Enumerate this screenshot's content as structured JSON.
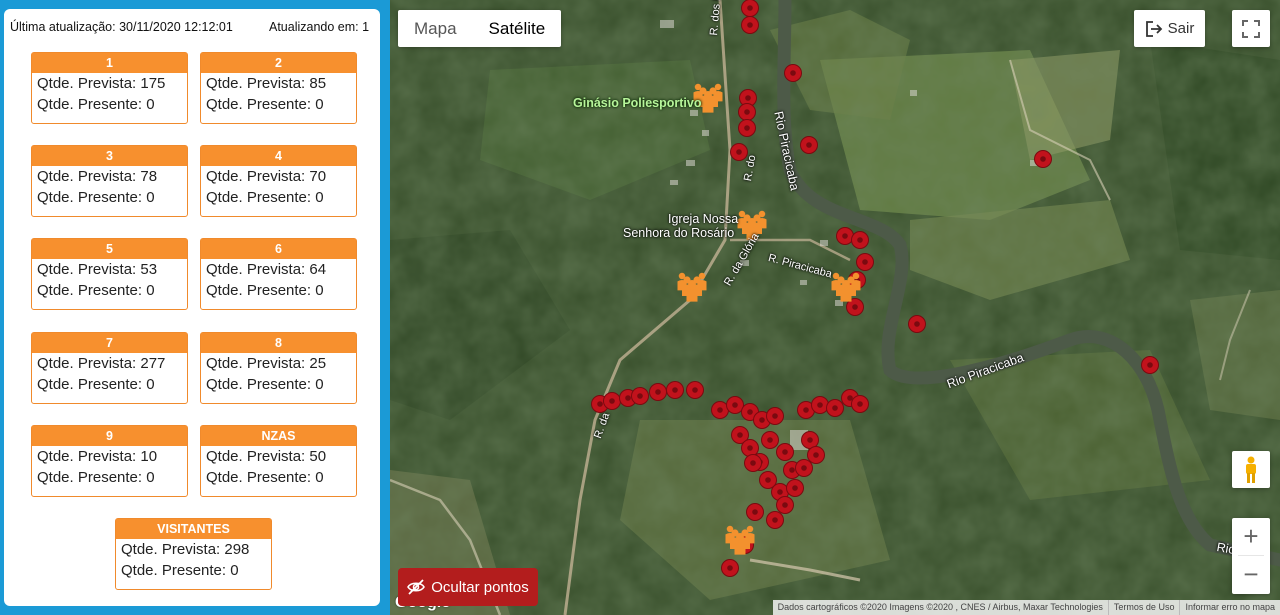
{
  "status": {
    "last_update_label": "Última atualização: 30/11/2020 12:12:01",
    "updating_label": "Atualizando em: 1"
  },
  "cards": [
    {
      "title": "1",
      "prevista": "Qtde. Prevista: 175",
      "presente": "Qtde. Presente: 0"
    },
    {
      "title": "2",
      "prevista": "Qtde. Prevista: 85",
      "presente": "Qtde. Presente: 0"
    },
    {
      "title": "3",
      "prevista": "Qtde. Prevista: 78",
      "presente": "Qtde. Presente: 0"
    },
    {
      "title": "4",
      "prevista": "Qtde. Prevista: 70",
      "presente": "Qtde. Presente: 0"
    },
    {
      "title": "5",
      "prevista": "Qtde. Prevista: 53",
      "presente": "Qtde. Presente: 0"
    },
    {
      "title": "6",
      "prevista": "Qtde. Prevista: 64",
      "presente": "Qtde. Presente: 0"
    },
    {
      "title": "7",
      "prevista": "Qtde. Prevista: 277",
      "presente": "Qtde. Presente: 0"
    },
    {
      "title": "8",
      "prevista": "Qtde. Prevista: 25",
      "presente": "Qtde. Presente: 0"
    },
    {
      "title": "9",
      "prevista": "Qtde. Prevista: 10",
      "presente": "Qtde. Presente: 0"
    },
    {
      "title": "NZAS",
      "prevista": "Qtde. Prevista: 50",
      "presente": "Qtde. Presente: 0"
    },
    {
      "title": "VISITANTES",
      "prevista": "Qtde. Prevista: 298",
      "presente": "Qtde. Presente: 0"
    }
  ],
  "map": {
    "type_options": [
      "Mapa",
      "Satélite"
    ],
    "active_type": "Satélite",
    "exit_label": "Sair",
    "hide_points_label": "Ocultar pontos",
    "zoom_in": "+",
    "zoom_out": "−",
    "google": "Google",
    "attribution": [
      "Dados cartográficos ©2020 Imagens ©2020 , CNES / Airbus, Maxar Technologies",
      "Termos de Uso",
      "Informar erro no mapa"
    ],
    "labels": [
      "Ginásio Poliesportivo",
      "Igreja Nossa",
      "Senhora do Rosário",
      "Rio Piracicaba",
      "Rio Piracicaba",
      "R. Piracicaba",
      "R. da Glória",
      "R. dos Pinheiros",
      "R. do",
      "R. da",
      "Rio"
    ],
    "colors": {
      "marker": "#c1121c",
      "person": "#f3912e",
      "hide_button": "#b31d1d",
      "card_header": "#f7902e",
      "panel_border": "#1b9ad6"
    }
  }
}
